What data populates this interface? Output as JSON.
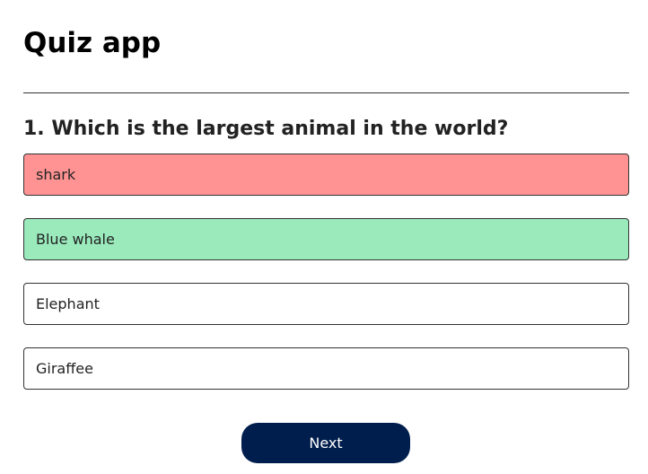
{
  "app": {
    "title": "Quiz app"
  },
  "question": {
    "text": "1. Which is the largest animal in the world?",
    "answers": [
      {
        "label": "shark",
        "state": "wrong",
        "color": "#ff9393"
      },
      {
        "label": "Blue whale",
        "state": "correct",
        "color": "#9aeabc"
      },
      {
        "label": "Elephant",
        "state": "neutral",
        "color": "#ffffff"
      },
      {
        "label": "Giraffee",
        "state": "neutral",
        "color": "#ffffff"
      }
    ]
  },
  "footer": {
    "next_label": "Next",
    "next_color": "#001e4d"
  }
}
